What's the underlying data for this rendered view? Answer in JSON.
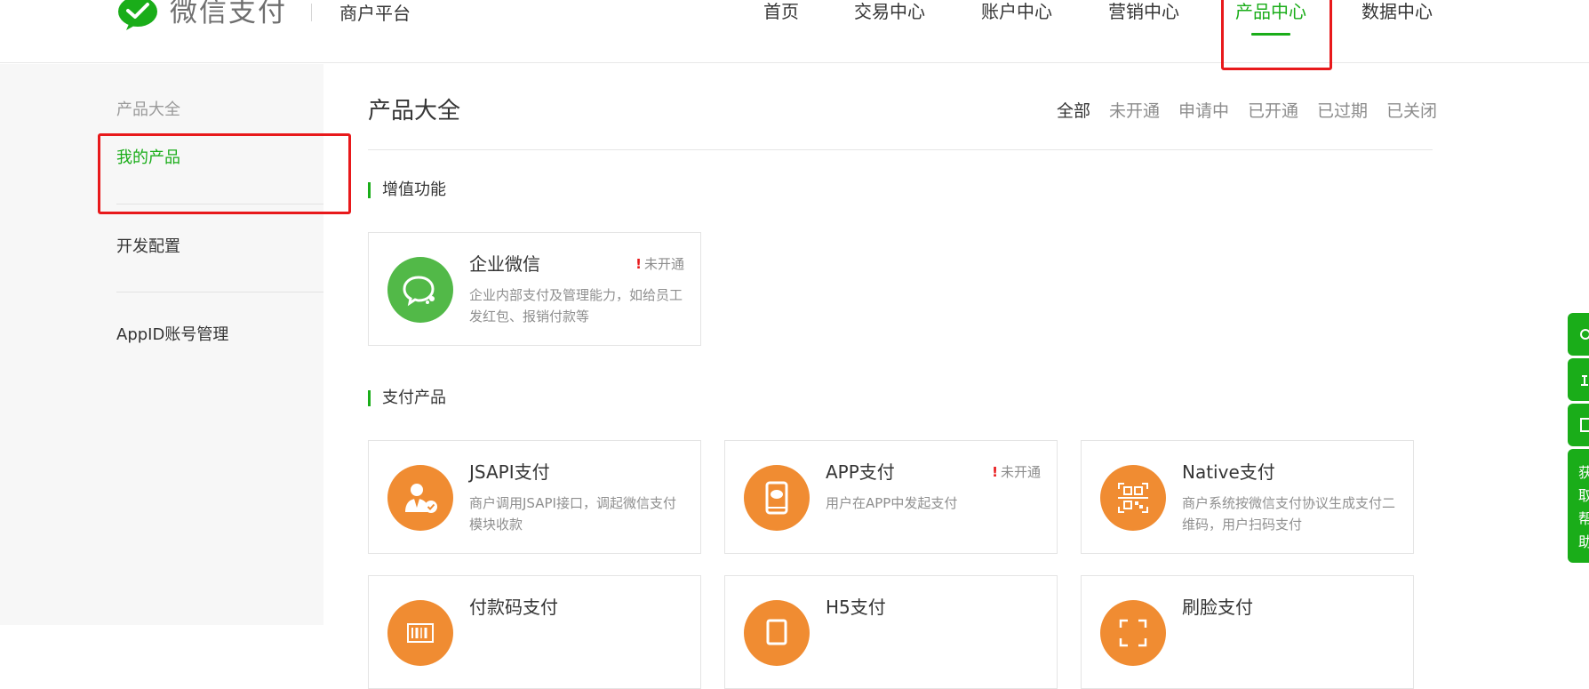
{
  "header": {
    "logo_text": "微信支付",
    "platform_title": "商户平台",
    "nav": [
      {
        "label": "首页",
        "active": false
      },
      {
        "label": "交易中心",
        "active": false
      },
      {
        "label": "账户中心",
        "active": false
      },
      {
        "label": "营销中心",
        "active": false
      },
      {
        "label": "产品中心",
        "active": true
      },
      {
        "label": "数据中心",
        "active": false
      }
    ]
  },
  "sidebar": {
    "heading": "产品大全",
    "items": [
      {
        "label": "我的产品",
        "active": true
      },
      {
        "label": "开发配置",
        "active": false
      },
      {
        "label": "AppID账号管理",
        "active": false
      }
    ]
  },
  "main": {
    "page_title": "产品大全",
    "filters": [
      {
        "label": "全部",
        "active": true
      },
      {
        "label": "未开通",
        "active": false
      },
      {
        "label": "申请中",
        "active": false
      },
      {
        "label": "已开通",
        "active": false
      },
      {
        "label": "已过期",
        "active": false
      },
      {
        "label": "已关闭",
        "active": false
      }
    ],
    "sections": [
      {
        "title": "增值功能",
        "cards": [
          {
            "title": "企业微信",
            "desc": "企业内部支付及管理能力，如给员工发红包、报销付款等",
            "status": "未开通",
            "icon": "wecom-chat-icon",
            "color": "#52b948"
          }
        ]
      },
      {
        "title": "支付产品",
        "cards": [
          {
            "title": "JSAPI支付",
            "desc": "商户调用JSAPI接口，调起微信支付模块收款",
            "status": "",
            "icon": "user-check-icon",
            "color": "#f08c32"
          },
          {
            "title": "APP支付",
            "desc": "用户在APP中发起支付",
            "status": "未开通",
            "icon": "mobile-app-icon",
            "color": "#f08c32"
          },
          {
            "title": "Native支付",
            "desc": "商户系统按微信支付协议生成支付二维码，用户扫码支付",
            "status": "",
            "icon": "qr-scan-icon",
            "color": "#f08c32"
          },
          {
            "title": "付款码支付",
            "desc": "",
            "status": "",
            "icon": "barcode-icon",
            "color": "#f08c32"
          },
          {
            "title": "H5支付",
            "desc": "",
            "status": "",
            "icon": "h5-screen-icon",
            "color": "#f08c32"
          },
          {
            "title": "刷脸支付",
            "desc": "",
            "status": "",
            "icon": "face-scan-icon",
            "color": "#f08c32"
          }
        ]
      }
    ]
  },
  "float_tabs": {
    "tab4_text": "获取帮助"
  },
  "colors": {
    "accent": "#1aad19",
    "orange": "#f08c32",
    "annotation": "#e8191b"
  }
}
